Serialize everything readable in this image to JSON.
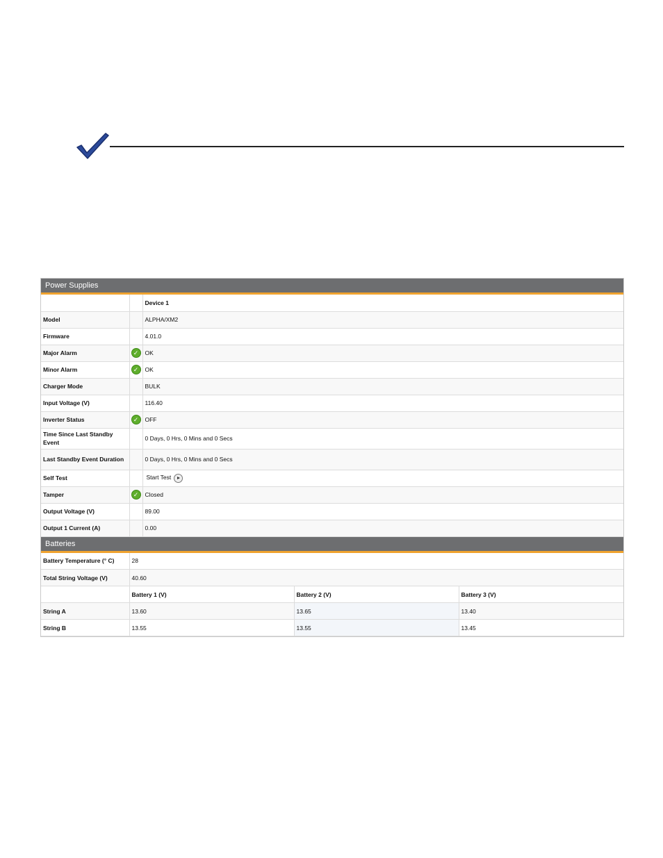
{
  "power": {
    "title": "Power Supplies",
    "device_header": "Device 1",
    "rows": [
      {
        "label": "Model",
        "value": "ALPHA/XM2"
      },
      {
        "label": "Firmware",
        "value": "4.01.0"
      },
      {
        "label": "Major Alarm",
        "value": "OK"
      },
      {
        "label": "Minor Alarm",
        "value": "OK"
      },
      {
        "label": "Charger Mode",
        "value": "BULK"
      },
      {
        "label": "Input Voltage (V)",
        "value": "116.40"
      },
      {
        "label": "Inverter Status",
        "value": "OFF"
      },
      {
        "label": "Time Since Last Standby Event",
        "value": "0 Days, 0 Hrs, 0 Mins and 0 Secs"
      },
      {
        "label": "Last Standby Event Duration",
        "value": "0 Days, 0 Hrs, 0 Mins and 0 Secs"
      },
      {
        "label": "Self Test",
        "value": "Start Test"
      },
      {
        "label": "Tamper",
        "value": "Closed"
      },
      {
        "label": "Output Voltage (V)",
        "value": "89.00"
      },
      {
        "label": "Output 1 Current (A)",
        "value": "0.00"
      }
    ]
  },
  "batteries": {
    "title": "Batteries",
    "temperature": {
      "label": "Battery Temperature (° C)",
      "value": "28"
    },
    "total_voltage": {
      "label": "Total String Voltage (V)",
      "value": "40.60"
    },
    "columns": [
      "Battery 1 (V)",
      "Battery 2 (V)",
      "Battery 3 (V)"
    ],
    "strings": [
      {
        "label": "String A",
        "values": [
          "13.60",
          "13.65",
          "13.40"
        ]
      },
      {
        "label": "String B",
        "values": [
          "13.55",
          "13.55",
          "13.45"
        ]
      }
    ]
  },
  "colors": {
    "header_bg": "#6d6e70",
    "accent": "#f0a32f",
    "ok_green": "#5fae2c",
    "check_blue": "#2c4a9a"
  }
}
